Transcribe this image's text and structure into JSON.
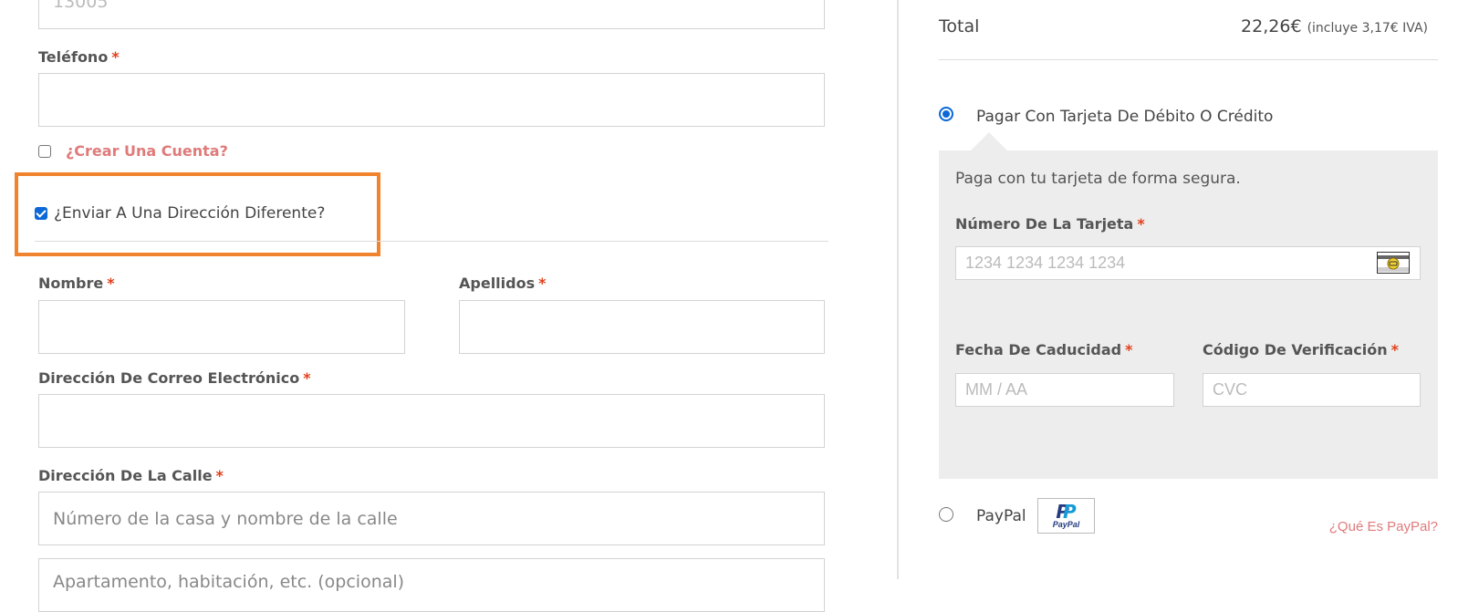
{
  "billing": {
    "postcode_value": "13005",
    "phone_label": "Teléfono",
    "required_mark": "*",
    "create_account_label": "¿Crear Una Cuenta?",
    "create_account_checked": false,
    "ship_different_label": "¿Enviar A Una Dirección Diferente?",
    "ship_different_checked": true
  },
  "shipping": {
    "first_name_label": "Nombre",
    "last_name_label": "Apellidos",
    "email_label": "Dirección De Correo Electrónico",
    "street_label": "Dirección De La Calle",
    "street_placeholder": "Número de la casa y nombre de la calle",
    "street2_placeholder": "Apartamento, habitación, etc. (opcional)"
  },
  "order": {
    "total_label": "Total",
    "total_value": "22,26€",
    "tax_note": "(incluye 3,17€ IVA)"
  },
  "payment": {
    "card_option_label": "Pagar Con Tarjeta De Débito O Crédito",
    "card_selected": true,
    "card_description": "Paga con tu tarjeta de forma segura.",
    "card_number_label": "Número De La Tarjeta",
    "card_number_placeholder": "1234 1234 1234 1234",
    "expiry_label": "Fecha De Caducidad",
    "expiry_placeholder": "MM / AA",
    "cvc_label": "Código De Verificación",
    "cvc_placeholder": "CVC",
    "paypal_label": "PayPal",
    "paypal_selected": false,
    "paypal_logo_text": "PayPal",
    "paypal_help_link": "¿Qué Es PayPal?"
  },
  "colors": {
    "accent_link": "#e07a7a",
    "highlight": "#f0842e",
    "radio_checked": "#0b68d6",
    "required": "#e2401c"
  }
}
